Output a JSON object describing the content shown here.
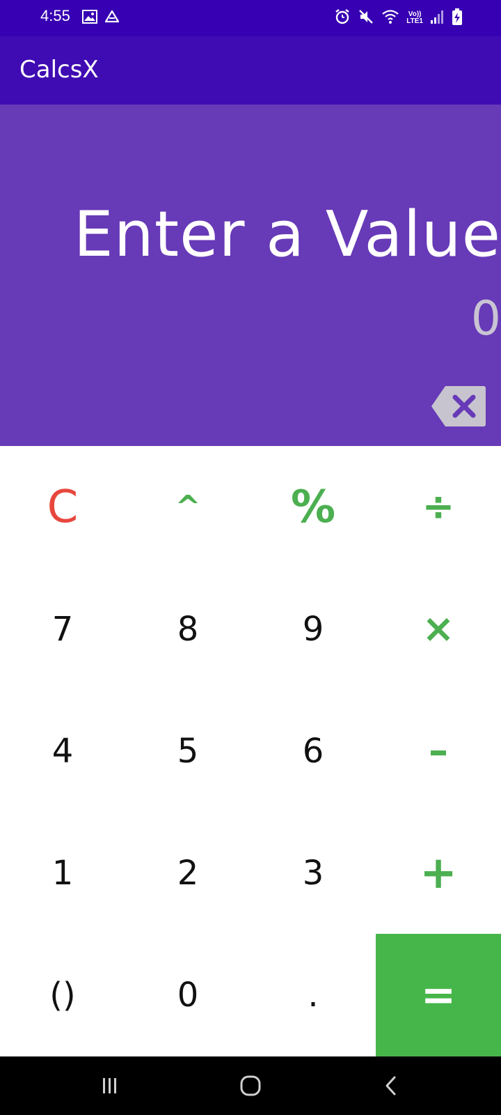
{
  "status_bar": {
    "time": "4:55",
    "left_icons": [
      "image-icon",
      "drive-icon"
    ],
    "right_icons": [
      "alarm-icon",
      "mute-icon",
      "wifi-icon",
      "volte-icon",
      "signal-icon",
      "battery-charging-icon"
    ],
    "network_label_top": "Vo))",
    "network_label_bottom": "LTE1"
  },
  "app_bar": {
    "title": "CalcsX"
  },
  "display": {
    "expression": "Enter a Value",
    "result": "0",
    "backspace_icon": "backspace-icon"
  },
  "keypad": {
    "rows": [
      [
        "C",
        "^",
        "%",
        "÷"
      ],
      [
        "7",
        "8",
        "9",
        "×"
      ],
      [
        "4",
        "5",
        "6",
        "–"
      ],
      [
        "1",
        "2",
        "3",
        "+"
      ],
      [
        "()",
        "0",
        ".",
        "="
      ]
    ]
  },
  "nav_bar": {
    "icons": [
      "recents-icon",
      "home-icon",
      "back-icon"
    ]
  },
  "colors": {
    "status_bar": "#3700b3",
    "app_bar": "#3f0bb3",
    "display": "#673ab7",
    "operator": "#4caf50",
    "clear": "#e8473d",
    "equals": "#47b64a"
  }
}
